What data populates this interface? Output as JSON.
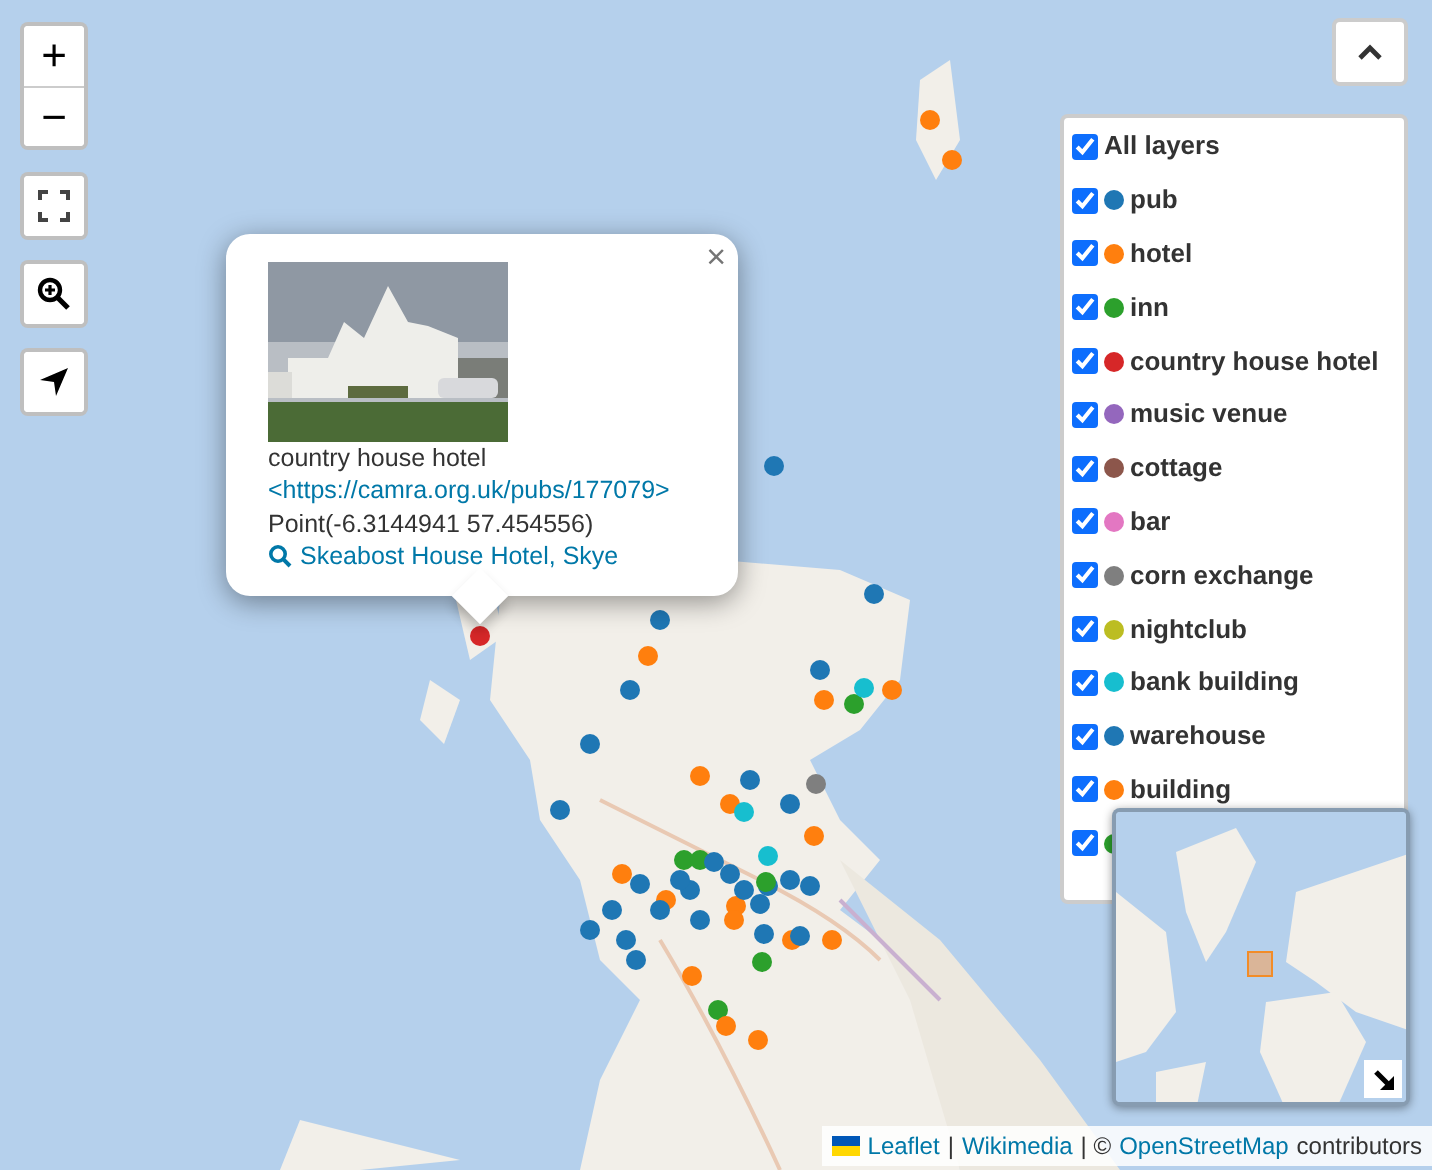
{
  "zoom_controls": {
    "zoom_in": "+",
    "zoom_out": "−"
  },
  "popup": {
    "close": "×",
    "category": "country house hotel",
    "link": "<https://camra.org.uk/pubs/177079>",
    "geometry": "Point(-6.3144941 57.454556)",
    "search_link": "Skeabost House Hotel, Skye"
  },
  "layers": {
    "all": {
      "label": "All layers",
      "checked": true
    },
    "items": [
      {
        "label": "pub",
        "checked": true,
        "color": "#1f77b4"
      },
      {
        "label": "hotel",
        "checked": true,
        "color": "#ff7f0e"
      },
      {
        "label": "inn",
        "checked": true,
        "color": "#2ca02c"
      },
      {
        "label": "country house hotel",
        "checked": true,
        "color": "#d62728"
      },
      {
        "label": "music venue",
        "checked": true,
        "color": "#9467bd"
      },
      {
        "label": "cottage",
        "checked": true,
        "color": "#8c564b"
      },
      {
        "label": "bar",
        "checked": true,
        "color": "#e377c2"
      },
      {
        "label": "corn exchange",
        "checked": true,
        "color": "#7f7f7f"
      },
      {
        "label": "nightclub",
        "checked": true,
        "color": "#bcbd22"
      },
      {
        "label": "bank building",
        "checked": true,
        "color": "#17becf"
      },
      {
        "label": "warehouse",
        "checked": true,
        "color": "#1f77b4"
      },
      {
        "label": "building",
        "checked": true,
        "color": "#ff7f0e"
      },
      {
        "checked": true,
        "color": "#2ca02c"
      }
    ]
  },
  "attribution": {
    "leaflet": "Leaflet",
    "sep1": "|",
    "wikimedia": "Wikimedia",
    "sep2": "| ©",
    "osm": "OpenStreetMap",
    "suffix": "contributors"
  }
}
